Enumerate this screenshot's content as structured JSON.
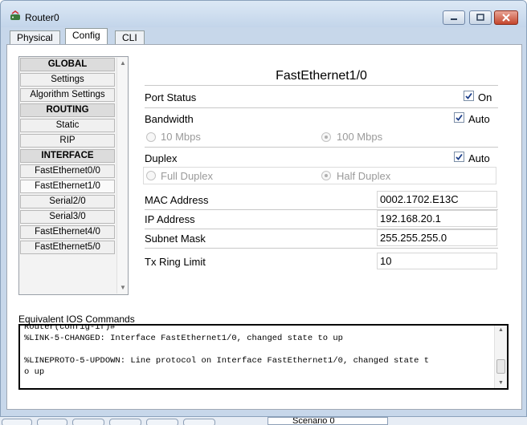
{
  "window": {
    "title": "Router0",
    "buttons": {
      "minimize": "minimize",
      "maximize": "maximize",
      "close": "close"
    }
  },
  "tabs": [
    {
      "label": "Physical",
      "active": false
    },
    {
      "label": "Config",
      "active": true
    },
    {
      "label": "CLI",
      "active": false
    }
  ],
  "sidebar": {
    "items": [
      {
        "label": "GLOBAL",
        "type": "header"
      },
      {
        "label": "Settings",
        "type": "item"
      },
      {
        "label": "Algorithm Settings",
        "type": "item"
      },
      {
        "label": "ROUTING",
        "type": "header"
      },
      {
        "label": "Static",
        "type": "item"
      },
      {
        "label": "RIP",
        "type": "item"
      },
      {
        "label": "INTERFACE",
        "type": "header"
      },
      {
        "label": "FastEthernet0/0",
        "type": "item"
      },
      {
        "label": "FastEthernet1/0",
        "type": "item",
        "selected": true
      },
      {
        "label": "Serial2/0",
        "type": "item"
      },
      {
        "label": "Serial3/0",
        "type": "item"
      },
      {
        "label": "FastEthernet4/0",
        "type": "item"
      },
      {
        "label": "FastEthernet5/0",
        "type": "item"
      }
    ]
  },
  "panel": {
    "title": "FastEthernet1/0",
    "port_status": {
      "label": "Port Status",
      "checkbox_label": "On",
      "checked": true
    },
    "bandwidth": {
      "label": "Bandwidth",
      "checkbox_label": "Auto",
      "checked": true,
      "options": [
        "10 Mbps",
        "100 Mbps"
      ],
      "selected": "100 Mbps"
    },
    "duplex": {
      "label": "Duplex",
      "checkbox_label": "Auto",
      "checked": true,
      "options": [
        "Full Duplex",
        "Half Duplex"
      ],
      "selected": "Half Duplex"
    },
    "mac_address": {
      "label": "MAC Address",
      "value": "0002.1702.E13C"
    },
    "ip_address": {
      "label": "IP Address",
      "value": "192.168.20.1"
    },
    "subnet_mask": {
      "label": "Subnet Mask",
      "value": "255.255.255.0"
    },
    "tx_ring_limit": {
      "label": "Tx Ring Limit",
      "value": "10"
    }
  },
  "equivalent_ios": {
    "label": "Equivalent IOS Commands",
    "text": "Router(config-if)#\n%LINK-5-CHANGED: Interface FastEthernet1/0, changed state to up\n\n%LINEPROTO-5-UPDOWN: Line protocol on Interface FastEthernet1/0, changed state t\no up"
  },
  "taskbar": {
    "scenario_label": "Scenario 0"
  },
  "colors": {
    "window_frame": "#c7d7ea",
    "close_button": "#c4452c",
    "header_item_bg": "#dcdcdc"
  }
}
